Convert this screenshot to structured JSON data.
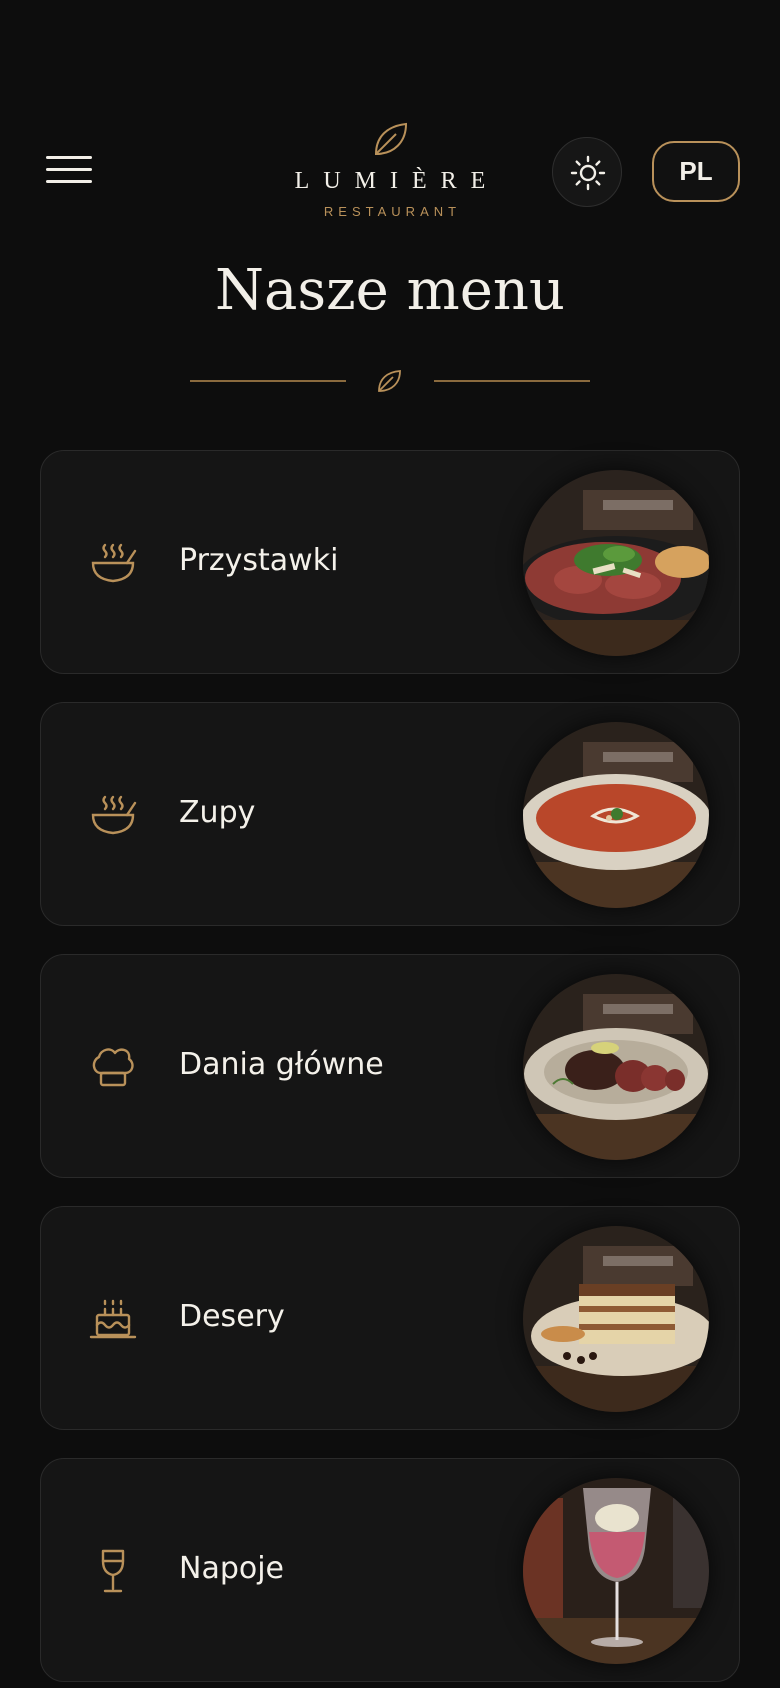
{
  "header": {
    "menu_icon": "hamburger-icon",
    "logo": {
      "name": "LUMIÈRE",
      "subtitle": "RESTAURANT",
      "icon": "leaf-icon"
    },
    "theme_icon": "sun-icon",
    "language": "PL"
  },
  "page": {
    "title": "Nasze menu",
    "divider_icon": "leaf-icon"
  },
  "categories": [
    {
      "label": "Przystawki",
      "icon": "bowl-icon",
      "photo": "carpaccio"
    },
    {
      "label": "Zupy",
      "icon": "bowl-icon",
      "photo": "tomato-soup"
    },
    {
      "label": "Dania główne",
      "icon": "chef-hat-icon",
      "photo": "steak"
    },
    {
      "label": "Desery",
      "icon": "cake-icon",
      "photo": "tiramisu"
    },
    {
      "label": "Napoje",
      "icon": "wine-glass-icon",
      "photo": "cocktail"
    }
  ],
  "colors": {
    "background": "#0d0d0d",
    "card": "#151515",
    "accent": "#b9915a",
    "text": "#f2efe8"
  }
}
